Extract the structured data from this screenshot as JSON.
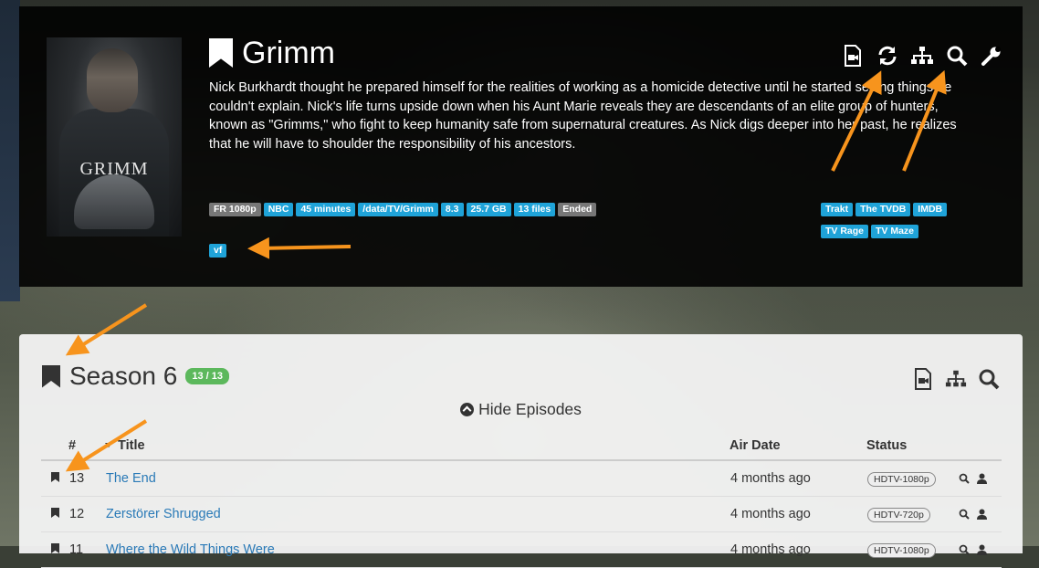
{
  "show": {
    "title": "Grimm",
    "poster_text": "GRIMM",
    "overview": "Nick Burkhardt thought he prepared himself for the realities of working as a homicide detective until he started seeing things he couldn't explain. Nick's life turns upside down when his Aunt Marie reveals they are descendants of an elite group of hunters, known as \"Grimms,\" who fight to keep humanity safe from supernatural creatures. As Nick digs deeper into her past, he realizes that he will have to shoulder the responsibility of his ancestors.",
    "tags": [
      {
        "label": "FR 1080p",
        "color": "grey"
      },
      {
        "label": "NBC",
        "color": "blue"
      },
      {
        "label": "45 minutes",
        "color": "blue"
      },
      {
        "label": "/data/TV/Grimm",
        "color": "blue"
      },
      {
        "label": "8.3",
        "color": "blue"
      },
      {
        "label": "25.7 GB",
        "color": "blue"
      },
      {
        "label": "13 files",
        "color": "blue"
      },
      {
        "label": "Ended",
        "color": "grey"
      }
    ],
    "language_tag": "vf",
    "external_links": [
      "Trakt",
      "The TVDB",
      "IMDB",
      "TV Rage",
      "TV Maze"
    ],
    "header_icons": [
      "file-video-icon",
      "refresh-icon",
      "sitemap-icon",
      "search-icon",
      "wrench-icon"
    ]
  },
  "season": {
    "title": "Season 6",
    "badge": "13 / 13",
    "toggle_label": "Hide Episodes",
    "icons": [
      "file-video-icon",
      "sitemap-icon",
      "search-icon"
    ],
    "columns": {
      "num": "#",
      "title": "Title",
      "air_date": "Air Date",
      "status": "Status"
    },
    "episodes": [
      {
        "num": "13",
        "title": "The End",
        "air_date": "4 months ago",
        "status": "HDTV-1080p"
      },
      {
        "num": "12",
        "title": "Zerstörer Shrugged",
        "air_date": "4 months ago",
        "status": "HDTV-720p"
      },
      {
        "num": "11",
        "title": "Where the Wild Things Were",
        "air_date": "4 months ago",
        "status": "HDTV-1080p"
      }
    ]
  },
  "colors": {
    "accent": "#1fa3d8",
    "grey_tag": "#777777",
    "green_badge": "#5cb85c",
    "arrow": "#f7941d",
    "link": "#2a7ab7"
  }
}
